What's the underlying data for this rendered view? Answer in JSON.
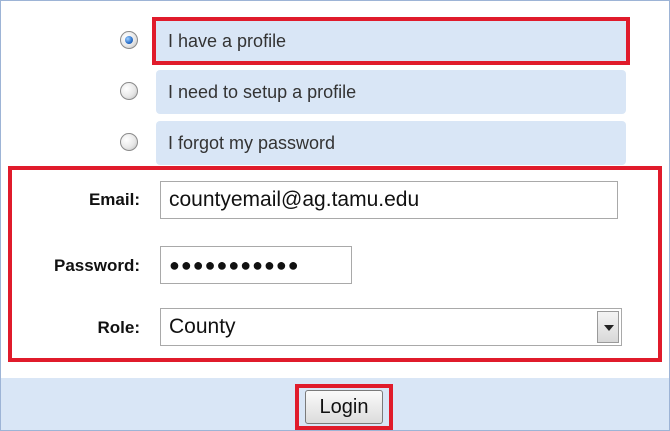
{
  "options": [
    {
      "label": "I have a profile",
      "checked": true
    },
    {
      "label": "I need to setup a profile",
      "checked": false
    },
    {
      "label": "I forgot my password",
      "checked": false
    }
  ],
  "form": {
    "email_label": "Email:",
    "email_value": "countyemail@ag.tamu.edu",
    "password_label": "Password:",
    "password_value": "●●●●●●●●●●●",
    "role_label": "Role:",
    "role_value": "County"
  },
  "login_label": "Login",
  "colors": {
    "highlight": "#e01b2b",
    "panel": "#d9e6f6"
  }
}
